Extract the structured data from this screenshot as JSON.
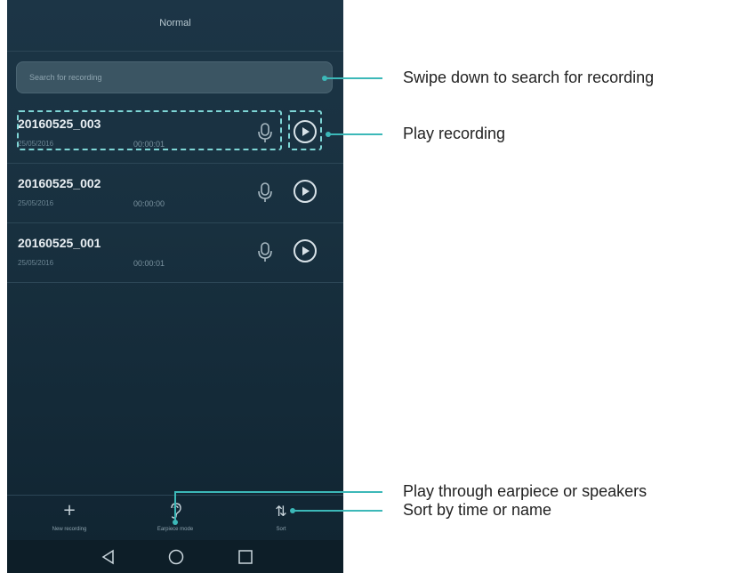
{
  "header": {
    "title": "Normal"
  },
  "search": {
    "placeholder": "Search for recording"
  },
  "recordings": [
    {
      "name": "20160525_003",
      "date": "25/05/2016",
      "duration": "00:00:01"
    },
    {
      "name": "20160525_002",
      "date": "25/05/2016",
      "duration": "00:00:00"
    },
    {
      "name": "20160525_001",
      "date": "25/05/2016",
      "duration": "00:00:01"
    }
  ],
  "toolbar": {
    "new_recording_label": "New recording",
    "new_recording_icon": "plus-icon",
    "earpiece_label": "Earpiece mode",
    "earpiece_icon": "ear-icon",
    "sort_label": "Sort",
    "sort_icon": "sort-icon"
  },
  "navigation": {
    "back_icon": "back-triangle-icon",
    "home_icon": "home-circle-icon",
    "recents_icon": "recents-square-icon"
  },
  "callouts": {
    "search": "Swipe down to search for recording",
    "play": "Play recording",
    "earpiece": "Play through earpiece or speakers",
    "sort": "Sort by time or name"
  },
  "colors": {
    "accent": "#3cb8b8",
    "background": "#18303f"
  }
}
